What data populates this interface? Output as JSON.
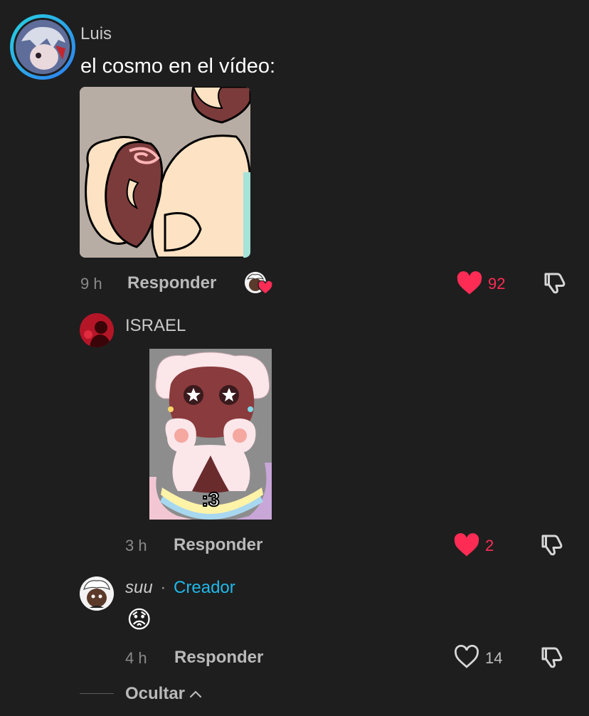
{
  "comments": [
    {
      "author": "Luis",
      "text": "el cosmo en el vídeo:",
      "time": "9 h",
      "reply_label": "Responder",
      "likes": "92",
      "liked": true
    },
    {
      "author": "ISRAEL",
      "image_caption": ":3",
      "time": "3 h",
      "reply_label": "Responder",
      "likes": "2",
      "liked": true
    },
    {
      "author": "suu",
      "separator": "·",
      "creator_label": "Creador",
      "emoji": "😟",
      "time": "4 h",
      "reply_label": "Responder",
      "likes": "14",
      "liked": false
    }
  ],
  "hide_label": "Ocultar",
  "colors": {
    "background": "#1e1e1e",
    "like_red": "#fe2c55",
    "creator_blue": "#20b8e8"
  }
}
